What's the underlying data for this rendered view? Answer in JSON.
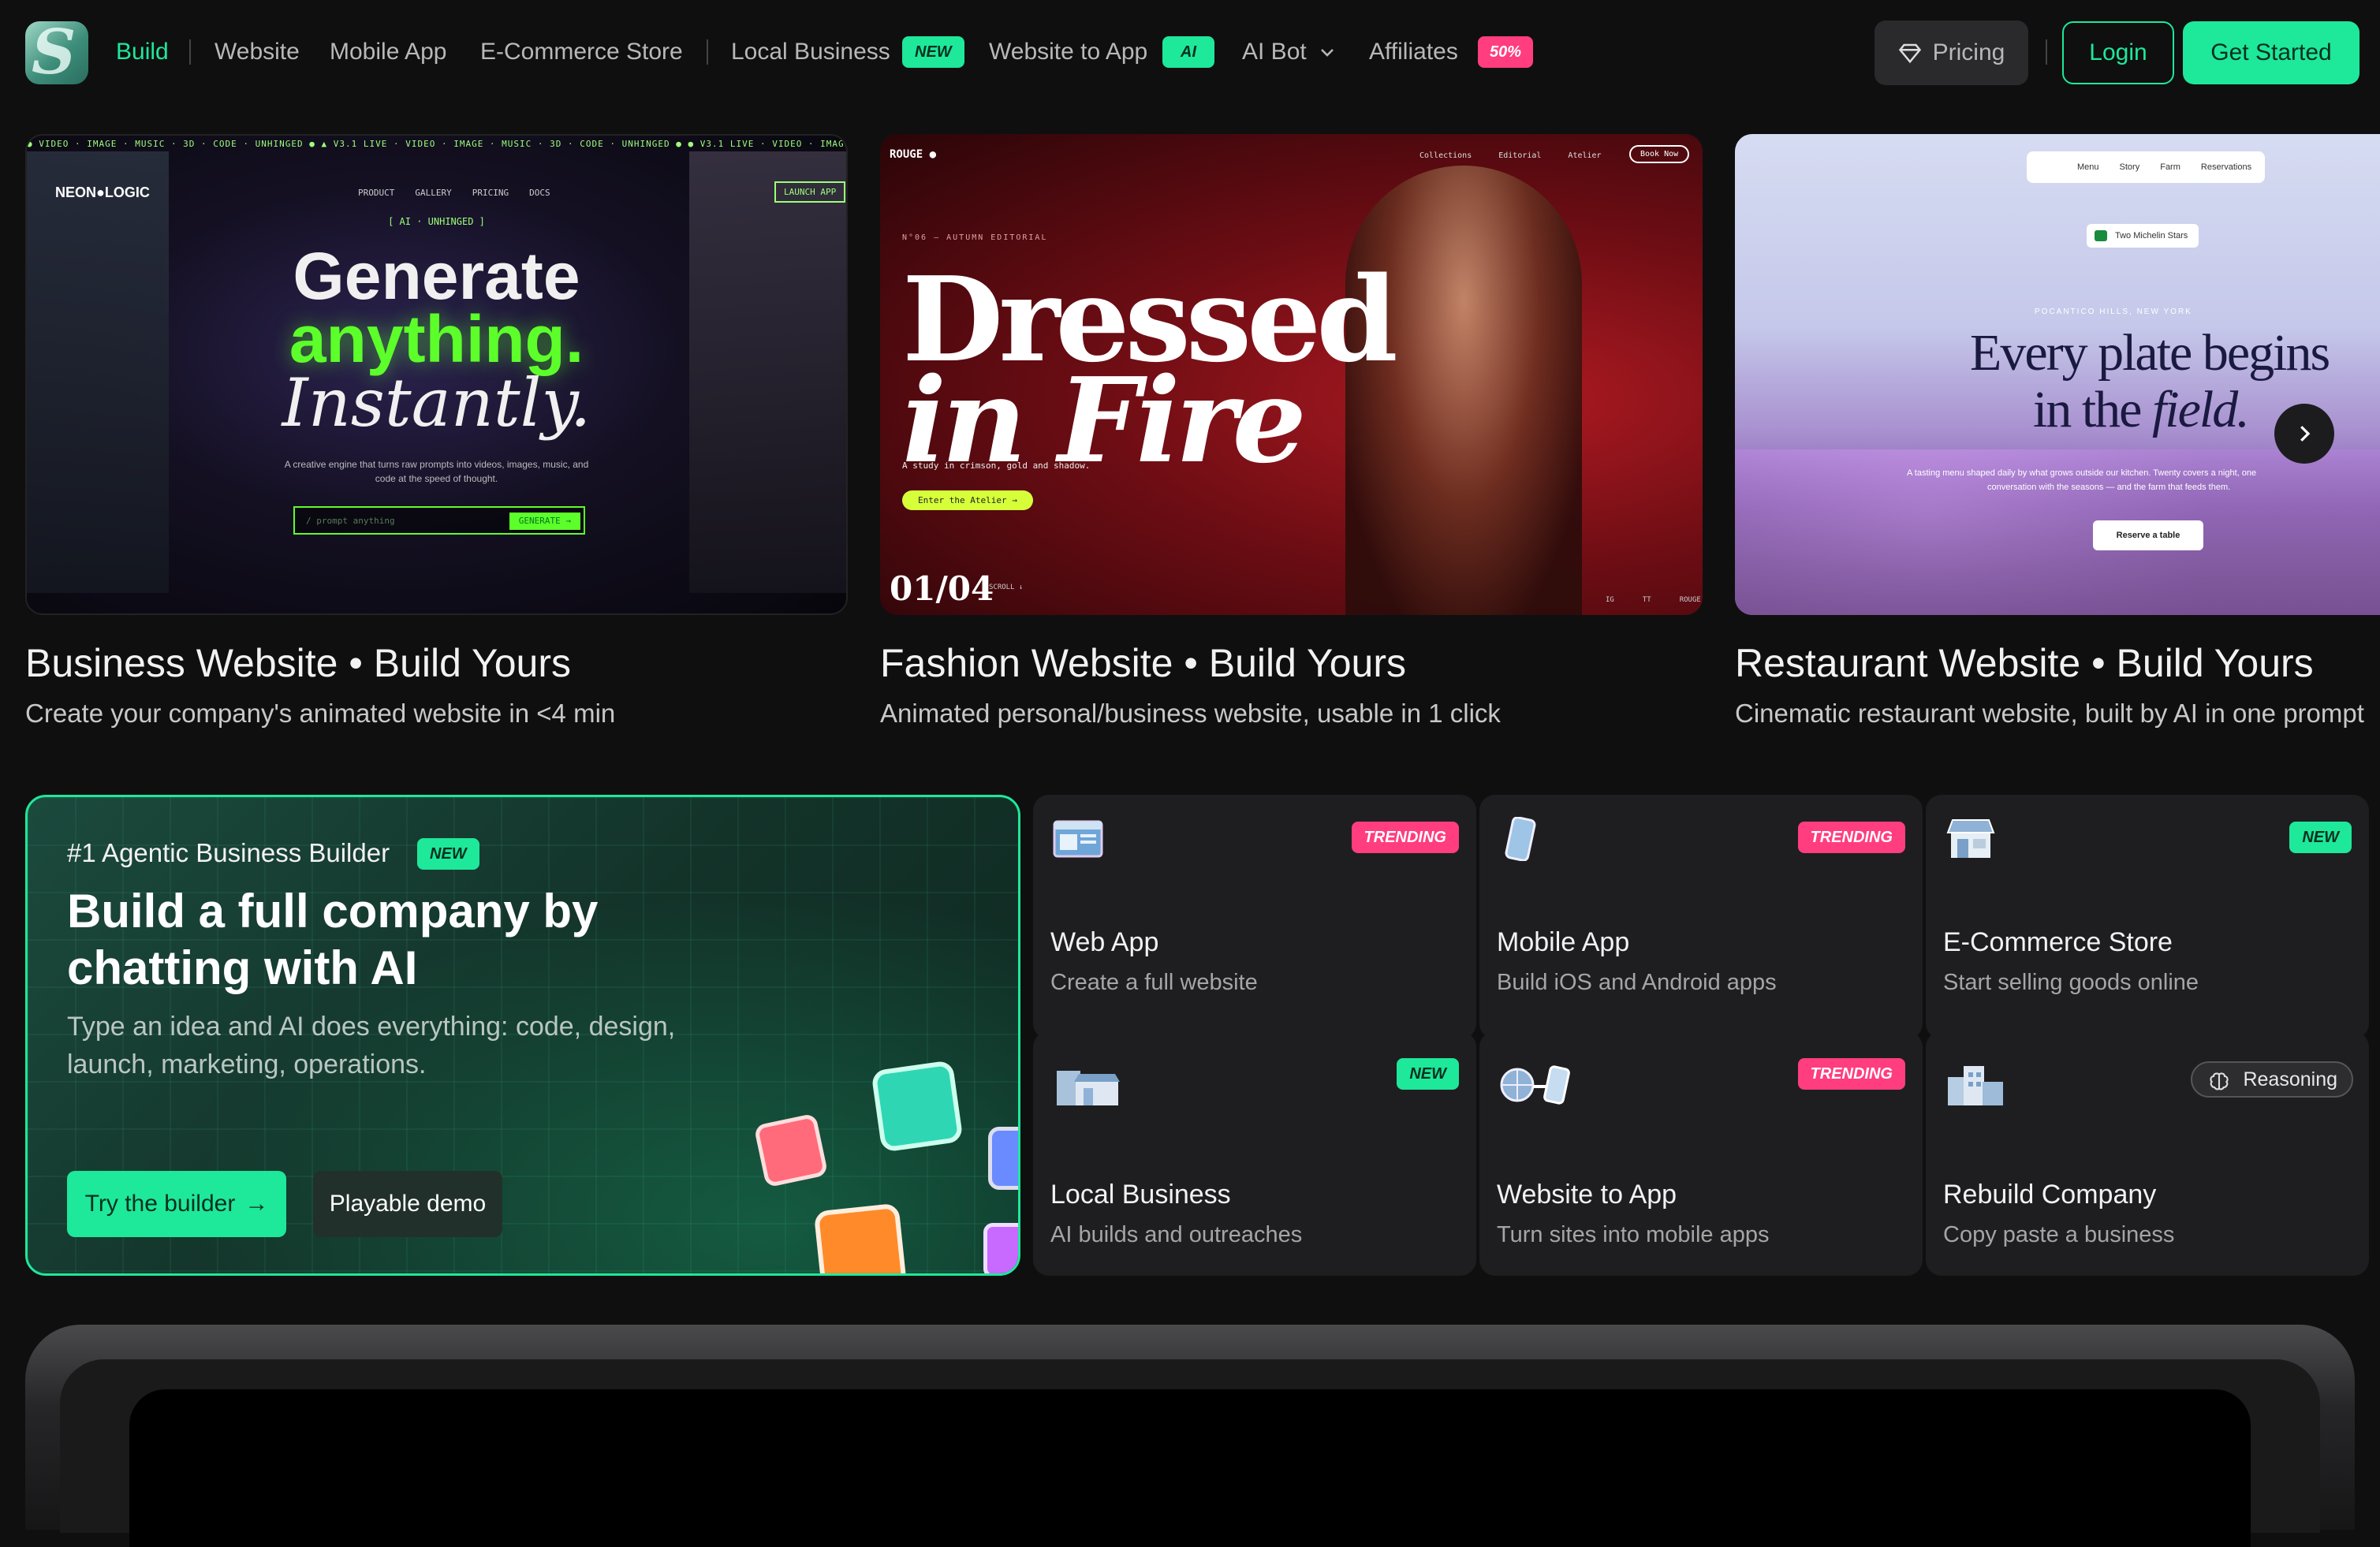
{
  "nav": {
    "logo_letter": "S",
    "build": "Build",
    "website": "Website",
    "mobile_app": "Mobile App",
    "ecommerce": "E-Commerce Store",
    "local_business": "Local Business",
    "local_badge": "NEW",
    "website_to_app": "Website to App",
    "wta_badge": "AI",
    "ai_bot": "AI Bot",
    "affiliates": "Affiliates",
    "aff_badge": "50%",
    "pricing": "Pricing",
    "login": "Login",
    "get_started": "Get Started"
  },
  "showcase": [
    {
      "title": "Business Website • Build Yours",
      "subtitle": "Create your company's animated website in <4 min",
      "preview": {
        "brand": "NEON●LOGIC",
        "menu": [
          "PRODUCT",
          "GALLERY",
          "PRICING",
          "DOCS"
        ],
        "cta": "LAUNCH APP",
        "tag": "[ AI · UNHINGED ]",
        "line1": "Generate",
        "line2": "anything.",
        "line3": "Instantly.",
        "desc1": "A creative engine that turns raw prompts into videos, images, music, and",
        "desc2": "code at the speed of thought.",
        "input": "/ prompt anything",
        "button": "GENERATE →",
        "ticker": "● VIDEO · IMAGE · MUSIC · 3D · CODE · UNHINGED ● ▲ V3.1 LIVE · VIDEO · IMAGE · MUSIC · 3D · CODE · UNHINGED ● ● V3.1 LIVE · VIDEO · IMAGE · MUSIC · 3D · CODE · UN"
      }
    },
    {
      "title": "Fashion Website • Build Yours",
      "subtitle": "Animated personal/business website, usable in 1 click",
      "preview": {
        "brand": "ROUGE ●",
        "menu": [
          "Collections",
          "Editorial",
          "Atelier"
        ],
        "cta": "Book Now",
        "issue": "N°06 — AUTUMN EDITORIAL",
        "line1": "Dressed",
        "line2": "in Fire",
        "desc": "A study in crimson, gold and shadow.",
        "button": "Enter the Atelier →",
        "counter": "01/04",
        "scroll": "SCROLL ↓",
        "foot": [
          "IG",
          "TT",
          "ROUGE"
        ]
      }
    },
    {
      "title": "Restaurant Website • Build Yours",
      "subtitle": "Cinematic restaurant website, built by AI in one prompt",
      "preview": {
        "menu": [
          "Menu",
          "Story",
          "Farm",
          "Reservations"
        ],
        "badge": "Two Michelin Stars",
        "location": "POCANTICO HILLS, NEW YORK",
        "line1": "Every plate begins",
        "line2": "in the",
        "line2_italic": "field.",
        "desc1": "A tasting menu shaped daily by what grows outside our kitchen. Twenty covers a night, one",
        "desc2": "conversation with the seasons — and the farm that feeds them.",
        "button": "Reserve a table"
      }
    }
  ],
  "hero": {
    "eyebrow": "#1 Agentic Business Builder",
    "badge": "NEW",
    "title1": "Build a full company by",
    "title2": "chatting with AI",
    "desc1": "Type an idea and AI does everything: code, design,",
    "desc2": "launch, marketing, operations.",
    "primary": "Try the builder",
    "primary_arrow": "→",
    "secondary": "Playable demo"
  },
  "tiles": [
    {
      "title": "Web App",
      "subtitle": "Create a full website",
      "badge": "TRENDING",
      "icon": "browser-window-icon"
    },
    {
      "title": "Mobile App",
      "subtitle": "Build iOS and Android apps",
      "badge": "TRENDING",
      "icon": "phone-icon"
    },
    {
      "title": "E-Commerce Store",
      "subtitle": "Start selling goods online",
      "badge": "NEW",
      "icon": "storefront-icon"
    },
    {
      "title": "Local Business",
      "subtitle": "AI builds and outreaches",
      "badge": "NEW",
      "icon": "shop-building-icon"
    },
    {
      "title": "Website to App",
      "subtitle": "Turn sites into mobile apps",
      "badge": "TRENDING",
      "icon": "globe-to-phone-icon"
    },
    {
      "title": "Rebuild Company",
      "subtitle": "Copy paste a business",
      "badge": "Reasoning",
      "icon": "office-buildings-icon"
    }
  ],
  "colors": {
    "accent": "#1ee89a",
    "pink": "#ff3d7f",
    "bg": "#0f0f10",
    "tile": "#1e1e20"
  }
}
